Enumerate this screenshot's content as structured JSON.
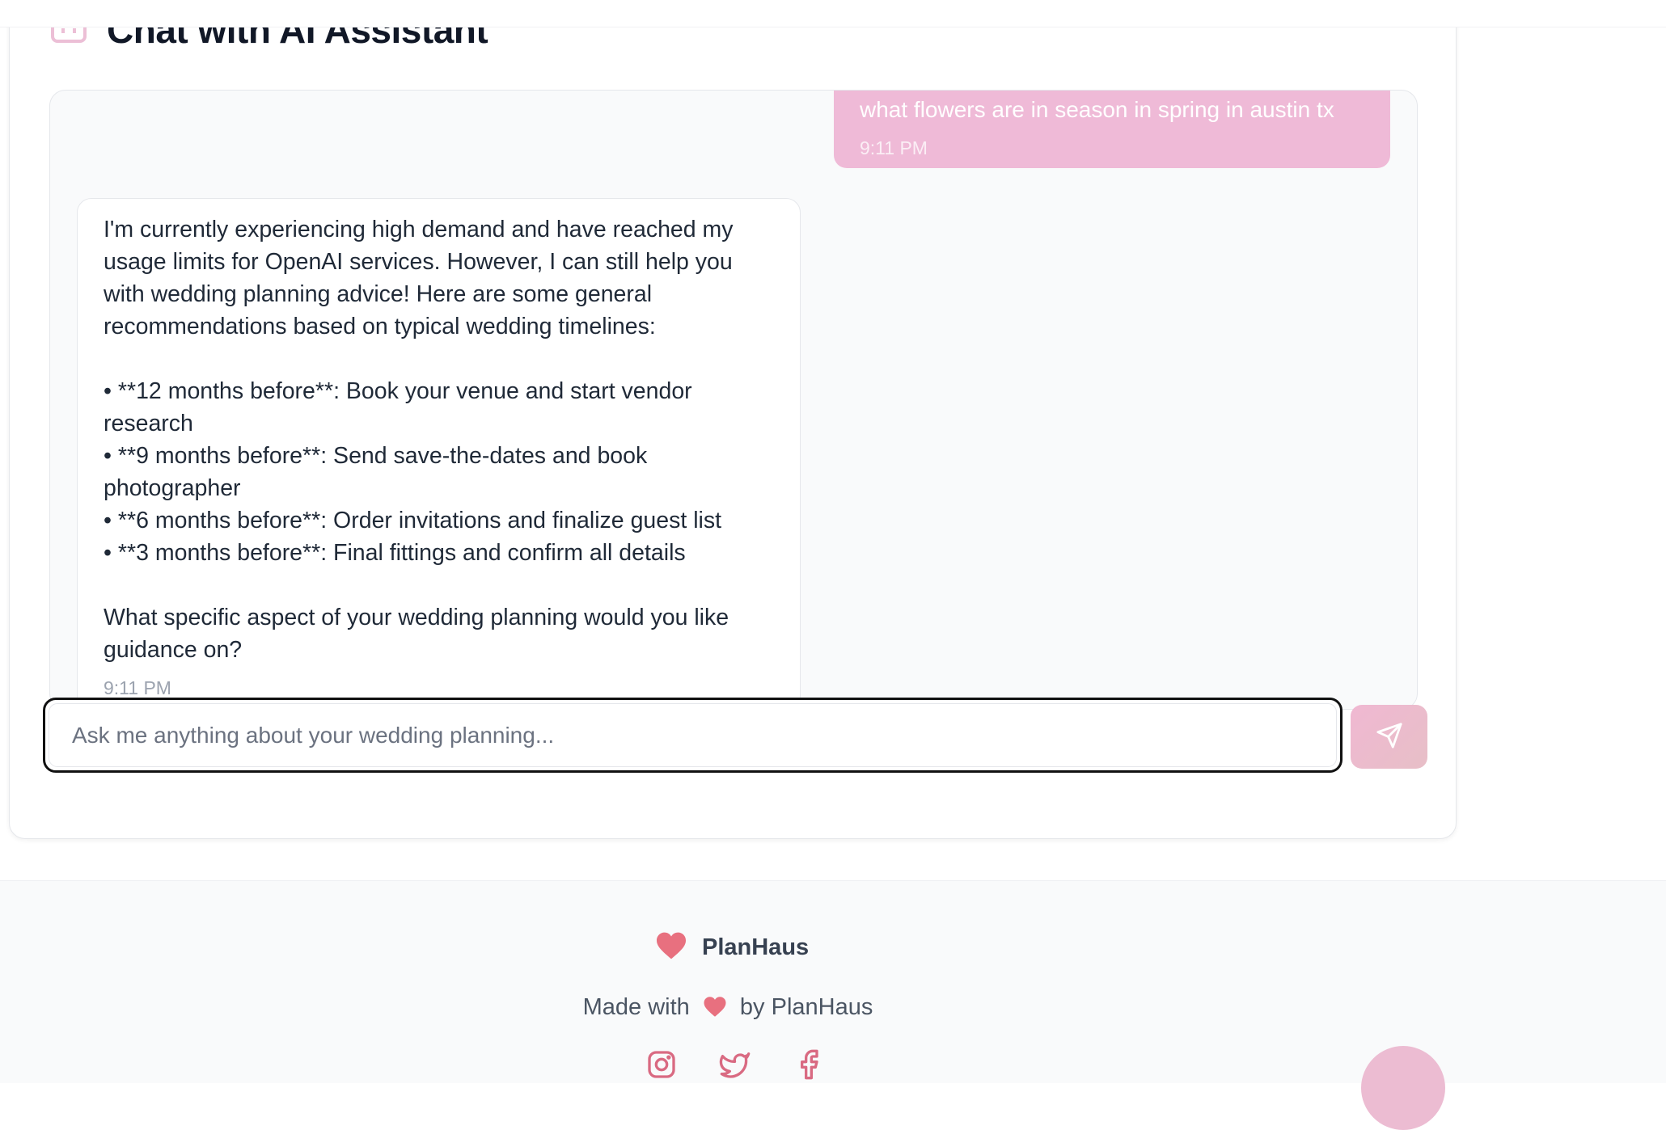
{
  "chat": {
    "title": "Chat with AI Assistant",
    "messages": [
      {
        "role": "user",
        "text": "what flowers are in season in spring in austin tx",
        "time": "9:11 PM"
      },
      {
        "role": "assistant",
        "text": "I'm currently experiencing high demand and have reached my usage limits for OpenAI services. However, I can still help you with wedding planning advice! Here are some general recommendations based on typical wedding timelines:\n\n• **12 months before**: Book your venue and start vendor research\n• **9 months before**: Send save-the-dates and book photographer\n• **6 months before**: Order invitations and finalize guest list\n• **3 months before**: Final fittings and confirm all details\n\nWhat specific aspect of your wedding planning would you like guidance on?",
        "time": "9:11 PM"
      }
    ],
    "input": {
      "placeholder": "Ask me anything about your wedding planning...",
      "value": ""
    },
    "send_icon": "send-icon"
  },
  "footer": {
    "brand": "PlanHaus",
    "made_with_prefix": "Made with",
    "made_with_suffix": "by PlanHaus",
    "socials": [
      "instagram-icon",
      "twitter-icon",
      "facebook-icon"
    ]
  },
  "colors": {
    "accent_pink": "#efbad7",
    "heart": "#e8707f",
    "icon_pink": "#d96a82"
  }
}
